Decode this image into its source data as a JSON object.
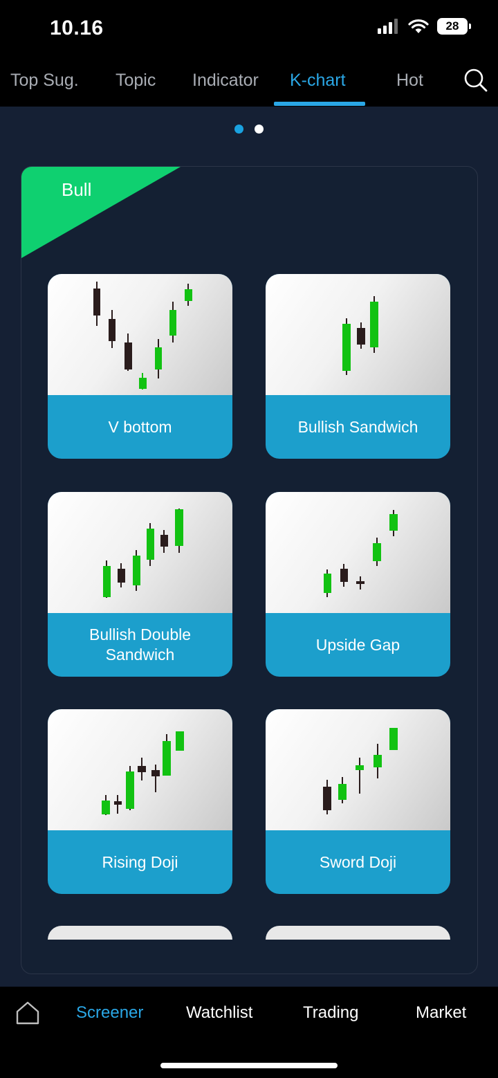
{
  "status": {
    "time": "10.16",
    "battery": "28"
  },
  "tabs": [
    {
      "label": "Top Sug.",
      "active": false
    },
    {
      "label": "Topic",
      "active": false
    },
    {
      "label": "Indicator",
      "active": false
    },
    {
      "label": "K-chart",
      "active": true
    },
    {
      "label": "Hot",
      "active": false
    }
  ],
  "pager": {
    "pages": 2,
    "current": 1
  },
  "section": {
    "label": "Bull"
  },
  "patterns": [
    {
      "label": "V bottom",
      "icon": "v-bottom-candles-icon"
    },
    {
      "label": "Bullish Sandwich",
      "icon": "bullish-sandwich-candles-icon"
    },
    {
      "label": "Bullish Double Sandwich",
      "icon": "bullish-double-sandwich-candles-icon"
    },
    {
      "label": "Upside Gap",
      "icon": "upside-gap-candles-icon"
    },
    {
      "label": "Rising Doji",
      "icon": "rising-doji-candles-icon"
    },
    {
      "label": "Sword Doji",
      "icon": "sword-doji-candles-icon"
    }
  ],
  "bottom_nav": [
    {
      "label": "Screener",
      "active": true
    },
    {
      "label": "Watchlist",
      "active": false
    },
    {
      "label": "Trading",
      "active": false
    },
    {
      "label": "Market",
      "active": false
    }
  ],
  "colors": {
    "accent": "#2aa7e6",
    "bull": "#0fd070",
    "candle_up": "#12c212",
    "candle_down": "#2a1c1c",
    "card_label_bg": "#1c9fcc"
  }
}
